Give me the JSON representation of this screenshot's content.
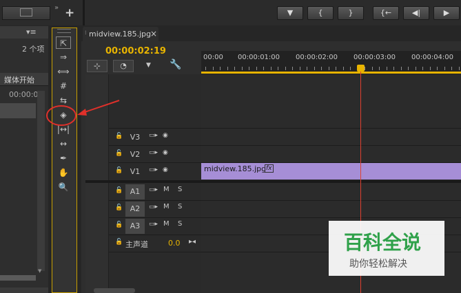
{
  "left_panel": {
    "item_count": "2 个项",
    "column_header": "媒体开始",
    "cell_value": "00:00:0"
  },
  "transport": {
    "add_icon": "+",
    "buttons": [
      {
        "name": "marker-button",
        "glyph": "▼"
      },
      {
        "name": "mark-in-button",
        "glyph": "{"
      },
      {
        "name": "mark-out-button",
        "glyph": "}"
      },
      {
        "name": "go-to-in-button",
        "glyph": "{←"
      },
      {
        "name": "step-back-button",
        "glyph": "◀|"
      },
      {
        "name": "play-button",
        "glyph": "▶"
      }
    ]
  },
  "tools": {
    "items": [
      {
        "name": "selection-tool-icon",
        "glyph": "⇱"
      },
      {
        "name": "track-select-tool-icon",
        "glyph": "⇒"
      },
      {
        "name": "ripple-edit-tool-icon",
        "glyph": "⟺"
      },
      {
        "name": "rolling-edit-tool-icon",
        "glyph": "#"
      },
      {
        "name": "rate-stretch-tool-icon",
        "glyph": "⇆"
      },
      {
        "name": "razor-tool-icon",
        "glyph": "◈"
      },
      {
        "name": "slip-tool-icon",
        "glyph": "|↔|"
      },
      {
        "name": "slide-tool-icon",
        "glyph": "↔"
      },
      {
        "name": "pen-tool-icon",
        "glyph": "✒"
      },
      {
        "name": "hand-tool-icon",
        "glyph": "✋"
      },
      {
        "name": "zoom-tool-icon",
        "glyph": "🔍"
      }
    ]
  },
  "sequence": {
    "tab_title": "midview.185.jpg",
    "tab_close": "×",
    "timecode": "00:00:02:19",
    "ruler_labels": [
      "00:00",
      "00:00:01:00",
      "00:00:02:00",
      "00:00:03:00",
      "00:00:04:00"
    ],
    "video_tracks": [
      "V3",
      "V2",
      "V1"
    ],
    "audio_tracks": [
      "A1",
      "A2",
      "A3"
    ],
    "mute_label": "M",
    "solo_label": "S",
    "master_label": "主声道",
    "master_value": "0.0",
    "clip_name": "midview.185.jpg",
    "clip_fx": "fx",
    "playhead_color": "#e04030",
    "clip_color": "#a68ed6",
    "timecode_color": "#e8b400"
  },
  "watermark": {
    "title": "百科全说",
    "subtitle": "助你轻松解决"
  }
}
